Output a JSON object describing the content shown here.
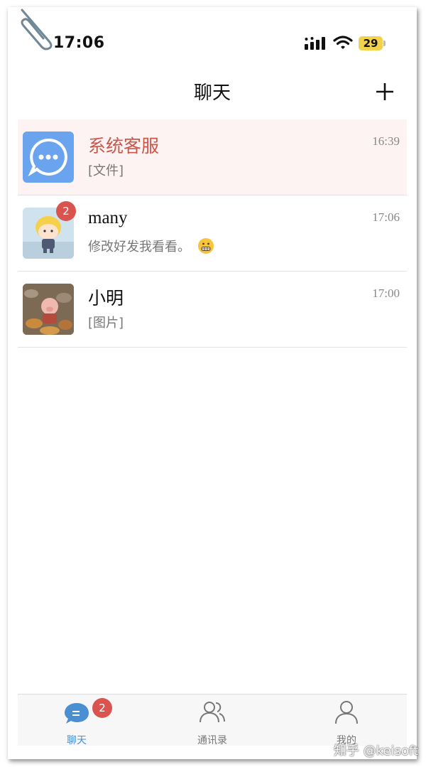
{
  "status_bar": {
    "time": "17:06",
    "battery": "29"
  },
  "nav": {
    "title": "聊天",
    "add_icon": "plus-icon"
  },
  "chats": [
    {
      "name": "系统客服",
      "preview": "[文件]",
      "time": "16:39",
      "pinned": true
    },
    {
      "name": "many",
      "preview": "修改好发我看看。",
      "time": "17:06",
      "unread": "2"
    },
    {
      "name": "小明",
      "preview": "[图片]",
      "time": "17:00"
    }
  ],
  "tabbar": {
    "tabs": [
      {
        "label": "聊天",
        "icon": "chat-bubble-icon",
        "badge": "2",
        "active": true
      },
      {
        "label": "通讯录",
        "icon": "contacts-icon"
      },
      {
        "label": "我的",
        "icon": "profile-icon"
      }
    ]
  },
  "colors": {
    "accent": "#4a8fd1",
    "badge": "#d9534f",
    "system_name": "#c9574c",
    "pinned_bg": "#fdf3f3"
  },
  "watermark": "知乎 @keisoft"
}
